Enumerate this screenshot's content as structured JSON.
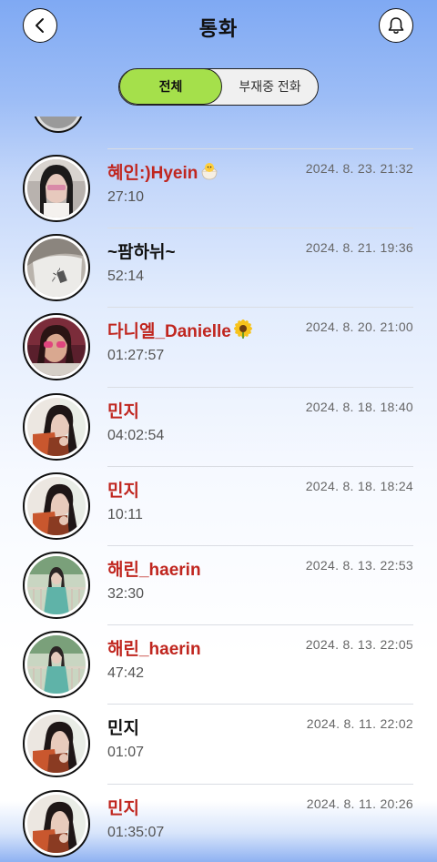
{
  "header": {
    "title": "통화",
    "back_icon": "chevron-left-icon",
    "bell_icon": "bell-icon"
  },
  "tabs": {
    "all_label": "전체",
    "missed_label": "부재중 전화",
    "active": "all",
    "active_color": "#a5e04b"
  },
  "colors": {
    "name_red": "#c0261f",
    "name_black": "#111111",
    "duration": "#555555",
    "date": "#666666"
  },
  "calls": [
    {
      "name": "혜인:)Hyein",
      "emoji": "chick-icon",
      "duration": "27:10",
      "date": "2024. 8. 23. 21:32",
      "color": "red"
    },
    {
      "name": "~팜하뉘~",
      "emoji": "",
      "duration": "52:14",
      "date": "2024. 8. 21. 19:36",
      "color": "black"
    },
    {
      "name": "다니엘_Danielle",
      "emoji": "sunflower-icon",
      "duration": "01:27:57",
      "date": "2024. 8. 20. 21:00",
      "color": "red"
    },
    {
      "name": "민지",
      "emoji": "",
      "duration": "04:02:54",
      "date": "2024. 8. 18. 18:40",
      "color": "red"
    },
    {
      "name": "민지",
      "emoji": "",
      "duration": "10:11",
      "date": "2024. 8. 18. 18:24",
      "color": "red"
    },
    {
      "name": "해린_haerin",
      "emoji": "",
      "duration": "32:30",
      "date": "2024. 8. 13. 22:53",
      "color": "red"
    },
    {
      "name": "해린_haerin",
      "emoji": "",
      "duration": "47:42",
      "date": "2024. 8. 13. 22:05",
      "color": "red"
    },
    {
      "name": "민지",
      "emoji": "",
      "duration": "01:07",
      "date": "2024. 8. 11. 22:02",
      "color": "black"
    },
    {
      "name": "민지",
      "emoji": "",
      "duration": "01:35:07",
      "date": "2024. 8. 11. 20:26",
      "color": "red"
    }
  ]
}
